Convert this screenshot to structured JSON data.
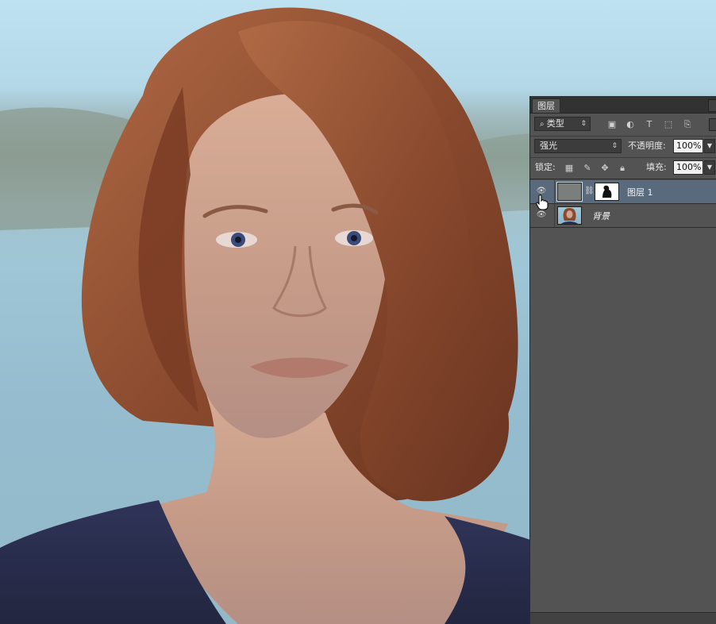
{
  "panel": {
    "tab_label": "图层",
    "filter_kind": "类型",
    "filter_icons": [
      "image-filter-icon",
      "adjustment-filter-icon",
      "type-filter-icon",
      "shape-filter-icon",
      "smart-object-filter-icon"
    ],
    "blend_mode": "强光",
    "opacity_label": "不透明度:",
    "opacity_value": "100%",
    "lock_label": "锁定:",
    "lock_icons": [
      "lock-transparent-icon",
      "lock-image-icon",
      "lock-position-icon",
      "lock-all-icon"
    ],
    "fill_label": "填充:",
    "fill_value": "100%"
  },
  "layers": [
    {
      "name": "图层 1",
      "selected": true,
      "has_mask": true,
      "visible": true
    },
    {
      "name": "背景",
      "selected": false,
      "has_mask": false,
      "visible": true
    }
  ],
  "colors": {
    "panel_bg": "#535353",
    "selected_layer": "#5a6a7d",
    "hair": "#8a4a2e",
    "shirt": "#2b2f52",
    "skin": "#c79e8b"
  }
}
